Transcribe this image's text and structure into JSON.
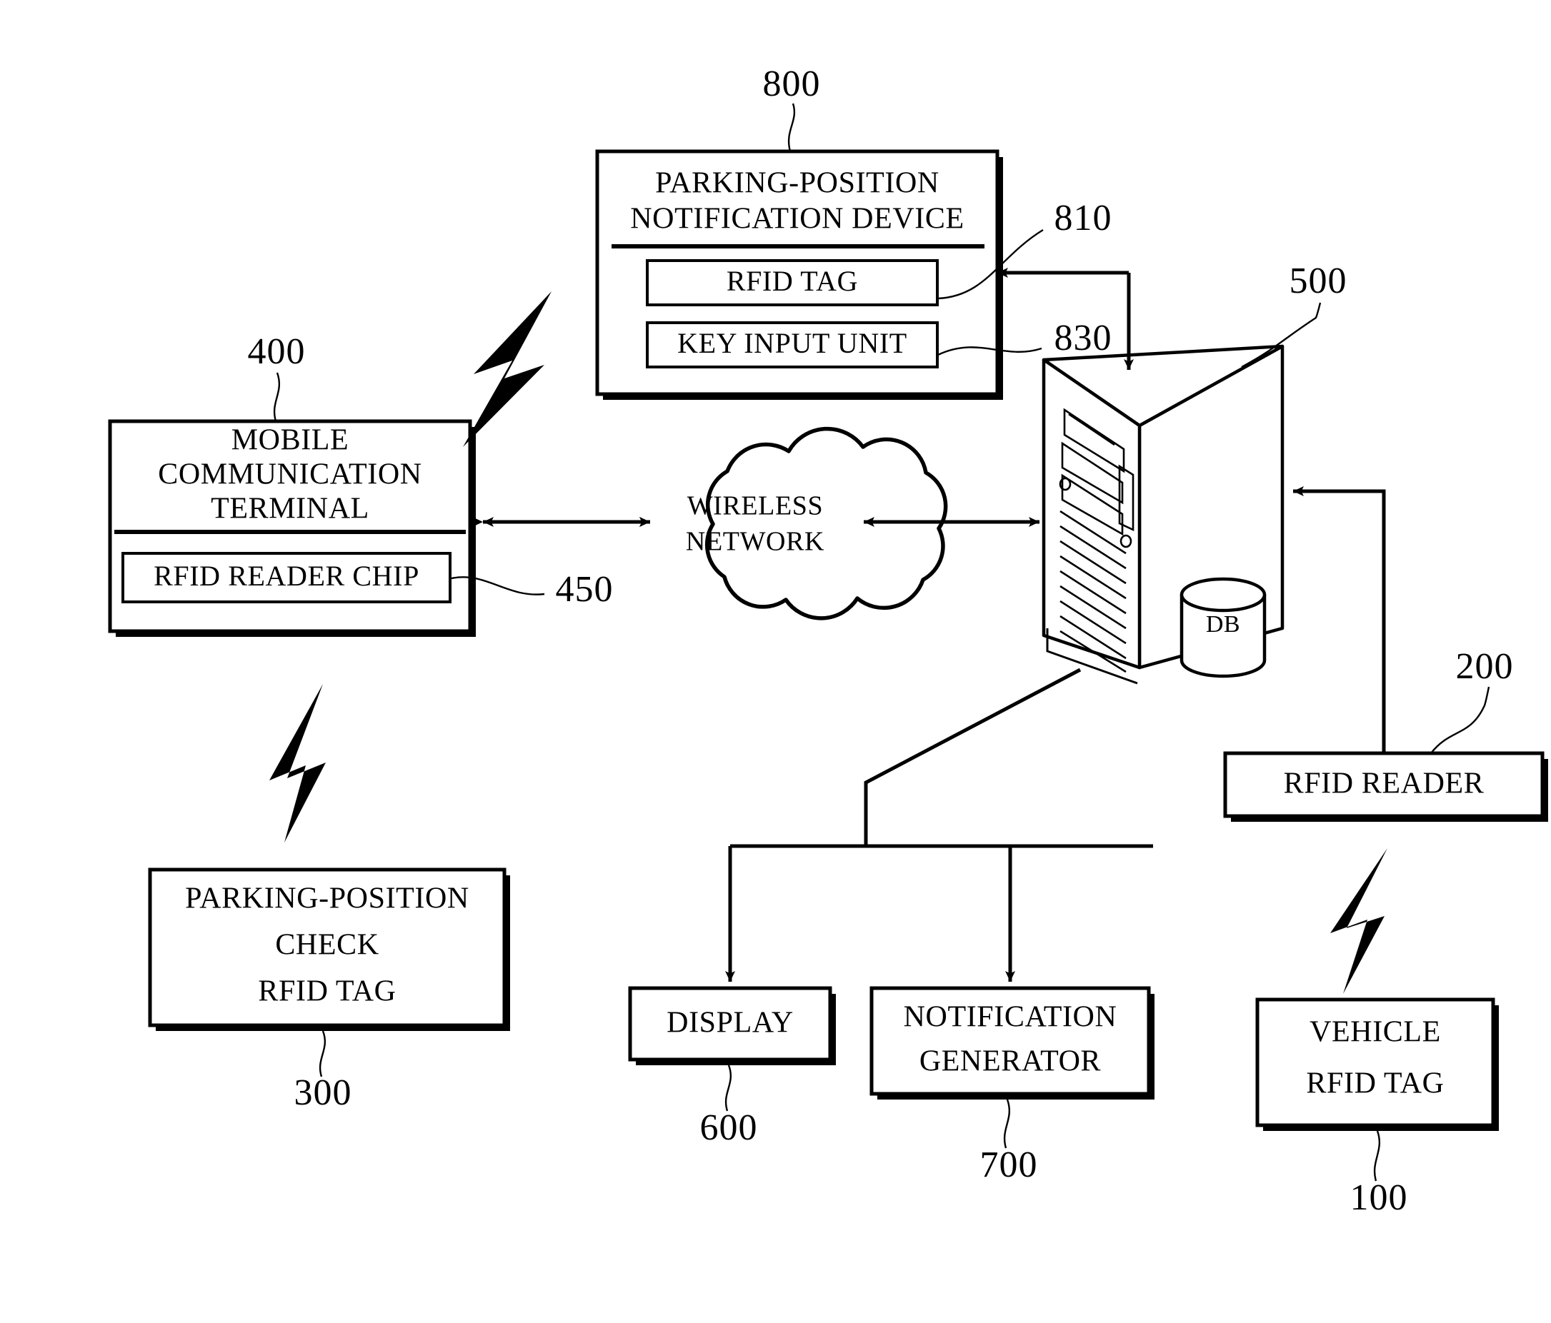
{
  "figure": {
    "title": "Parking-position notification system block diagram",
    "line_color": "#000000",
    "background_color": "#ffffff"
  },
  "blocks": {
    "notification_device": {
      "ref": "800",
      "title_line1": "PARKING-POSITION",
      "title_line2": "NOTIFICATION DEVICE",
      "children": [
        {
          "ref": "810",
          "label": "RFID TAG"
        },
        {
          "ref": "830",
          "label": "KEY INPUT UNIT"
        }
      ]
    },
    "mobile_terminal": {
      "ref": "400",
      "title_line1": "MOBILE",
      "title_line2": "COMMUNICATION",
      "title_line3": "TERMINAL",
      "children": [
        {
          "ref": "450",
          "label": "RFID READER CHIP"
        }
      ]
    },
    "parking_check_tag": {
      "ref": "300",
      "line1": "PARKING-POSITION",
      "line2": "CHECK",
      "line3": "RFID TAG"
    },
    "wireless_network": {
      "line1": "WIRELESS",
      "line2": "NETWORK"
    },
    "server": {
      "ref": "500",
      "db_label": "DB"
    },
    "display": {
      "ref": "600",
      "label": "DISPLAY"
    },
    "notification_generator": {
      "ref": "700",
      "line1": "NOTIFICATION",
      "line2": "GENERATOR"
    },
    "rfid_reader": {
      "ref": "200",
      "label": "RFID READER"
    },
    "vehicle_tag": {
      "ref": "100",
      "line1": "VEHICLE",
      "line2": "RFID TAG"
    }
  },
  "icons": {
    "bolt_device_to_terminal": "lightning-bolt-icon",
    "bolt_terminal_to_tag": "lightning-bolt-icon",
    "bolt_reader_to_vehicle": "lightning-bolt-icon"
  }
}
